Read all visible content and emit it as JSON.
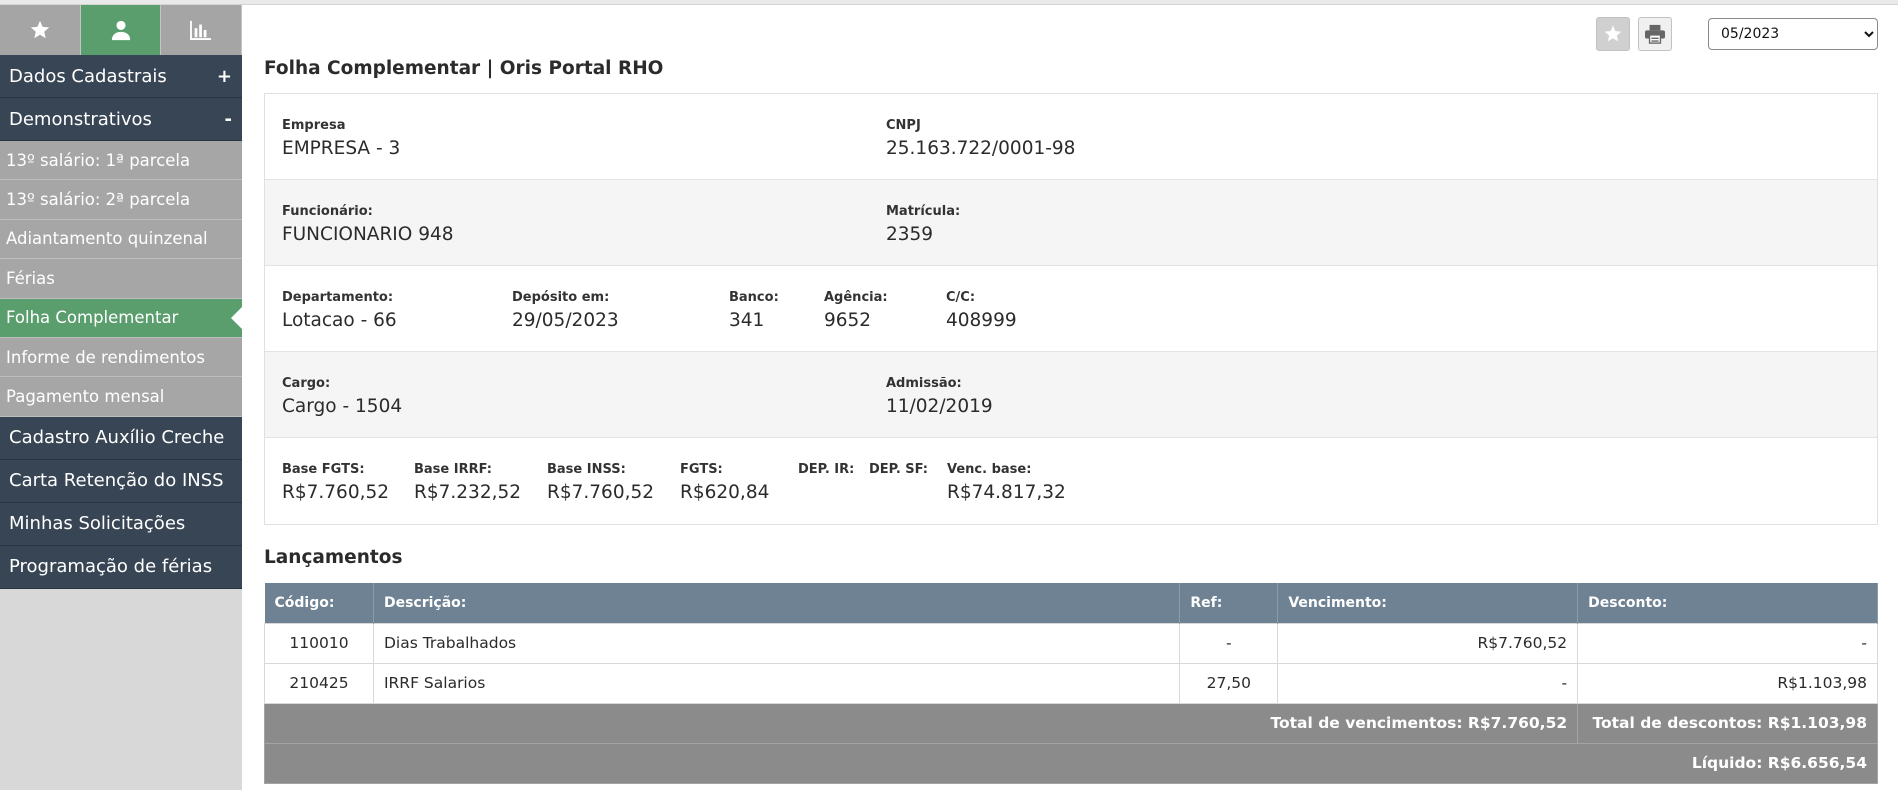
{
  "sidebar": {
    "tabs": [
      {
        "icon": "star-icon"
      },
      {
        "icon": "user-icon",
        "active": true
      },
      {
        "icon": "chart-icon"
      }
    ],
    "sections": {
      "dados_cadastrais": {
        "label": "Dados Cadastrais",
        "sign": "+"
      },
      "demonstrativos": {
        "label": "Demonstrativos",
        "sign": "-"
      }
    },
    "items": [
      "13º salário: 1ª parcela",
      "13º salário: 2ª parcela",
      "Adiantamento quinzenal",
      "Férias",
      "Folha Complementar",
      "Informe de rendimentos",
      "Pagamento mensal"
    ],
    "bottom_sections": [
      "Cadastro Auxílio Creche",
      "Carta Retenção do INSS",
      "Minhas Solicitações",
      "Programação de férias"
    ]
  },
  "toolbar": {
    "month_selected": "05/2023"
  },
  "page": {
    "title": "Folha Complementar | Oris Portal RHO"
  },
  "info": {
    "empresa": {
      "label": "Empresa",
      "value": "EMPRESA - 3"
    },
    "cnpj": {
      "label": "CNPJ",
      "value": "25.163.722/0001-98"
    },
    "funcionario": {
      "label": "Funcionário:",
      "value": "FUNCIONARIO 948"
    },
    "matricula": {
      "label": "Matrícula:",
      "value": "2359"
    },
    "departamento": {
      "label": "Departamento:",
      "value": "Lotacao - 66"
    },
    "deposito": {
      "label": "Depósito em:",
      "value": "29/05/2023"
    },
    "banco": {
      "label": "Banco:",
      "value": "341"
    },
    "agencia": {
      "label": "Agência:",
      "value": "9652"
    },
    "cc": {
      "label": "C/C:",
      "value": "408999"
    },
    "cargo": {
      "label": "Cargo:",
      "value": "Cargo - 1504"
    },
    "admissao": {
      "label": "Admissão:",
      "value": "11/02/2019"
    },
    "base_fgts": {
      "label": "Base FGTS:",
      "value": "R$7.760,52"
    },
    "base_irrf": {
      "label": "Base IRRF:",
      "value": "R$7.232,52"
    },
    "base_inss": {
      "label": "Base INSS:",
      "value": "R$7.760,52"
    },
    "fgts": {
      "label": "FGTS:",
      "value": "R$620,84"
    },
    "dep_ir": {
      "label": "DEP. IR:",
      "value": ""
    },
    "dep_sf": {
      "label": "DEP. SF:",
      "value": ""
    },
    "venc_base": {
      "label": "Venc. base:",
      "value": "R$74.817,32"
    }
  },
  "lancamentos": {
    "title": "Lançamentos",
    "headers": {
      "codigo": "Código:",
      "descricao": "Descrição:",
      "ref": "Ref:",
      "vencimento": "Vencimento:",
      "desconto": "Desconto:"
    },
    "rows": [
      {
        "codigo": "110010",
        "descricao": "Dias Trabalhados",
        "ref": "-",
        "vencimento": "R$7.760,52",
        "desconto": "-"
      },
      {
        "codigo": "210425",
        "descricao": "IRRF Salarios",
        "ref": "27,50",
        "vencimento": "-",
        "desconto": "R$1.103,98"
      }
    ],
    "total_vencimentos": "Total de vencimentos: R$7.760,52",
    "total_descontos": "Total de descontos: R$1.103,98",
    "liquido": "Líquido: R$6.656,54"
  }
}
